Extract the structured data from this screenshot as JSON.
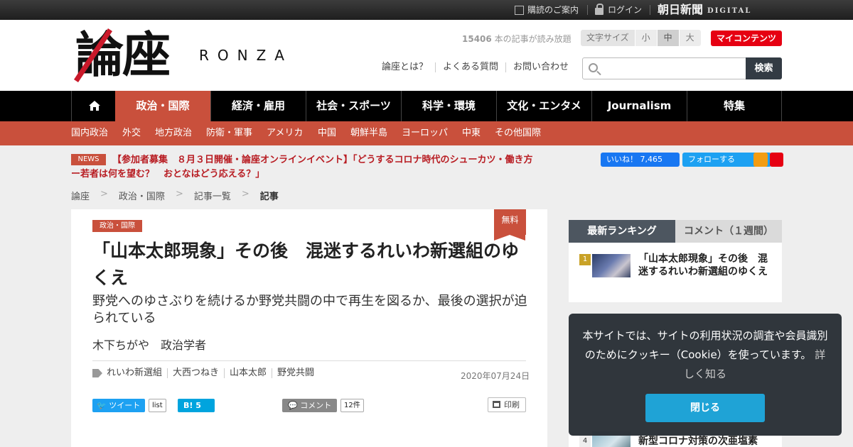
{
  "topbar": {
    "subscribe": "購読のご案内",
    "login": "ログイン",
    "asahi_logo": "朝日新聞",
    "digital": "DIGITAL"
  },
  "header": {
    "logo_kanji": "論座",
    "logo_roman": "RONZA",
    "read_count": "15406",
    "read_count_suffix": "本の記事が読み放題",
    "font_size_label": "文字サイズ",
    "font_sizes": [
      "小",
      "中",
      "大"
    ],
    "font_size_selected": "中",
    "my_content": "マイコンテンツ",
    "links": [
      "論座とは？",
      "よくある質問",
      "お問い合わせ"
    ],
    "search_placeholder": "",
    "search_button": "検索"
  },
  "nav": {
    "tabs": [
      "政治・国際",
      "経済・雇用",
      "社会・スポーツ",
      "科学・環境",
      "文化・エンタメ",
      "Journalism",
      "特集"
    ],
    "active": "政治・国際",
    "subnav": [
      "国内政治",
      "外交",
      "地方政治",
      "防衛・軍事",
      "アメリカ",
      "中国",
      "朝鮮半島",
      "ヨーロッパ",
      "中東",
      "その他国際"
    ]
  },
  "news": {
    "badge": "NEWS",
    "text": "【参加者募集　８月３日開催・論座オンラインイベント】「どうするコロナ時代のシューカツ・働き方ー若者は何を望む？　おとなはどう応える？」"
  },
  "social": {
    "fb_like": "いいね！",
    "fb_count": "7,465",
    "tw_follow": "フォローする"
  },
  "breadcrumb": [
    "論座",
    "政治・国際",
    "記事一覧",
    "記事"
  ],
  "article": {
    "category": "政治・国際",
    "free_badge": "無料",
    "title": "「山本太郎現象」その後　混迷するれいわ新選組のゆくえ",
    "subtitle": "野党へのゆさぶりを続けるか野党共闘の中で再生を図るか、最後の選択が迫られている",
    "author": "木下ちがや　政治学者",
    "tags": [
      "れいわ新選組",
      "大西つねき",
      "山本太郎",
      "野党共闘"
    ],
    "date": "2020年07月24日",
    "tweet": "ツイート",
    "tweet_list": "list",
    "hatena": "B!",
    "hatena_count": "5",
    "comment": "コメント",
    "comment_count": "12件",
    "print": "印刷"
  },
  "sidebar": {
    "tab_ranking": "最新ランキング",
    "tab_comment": "コメント（１週間）",
    "items": [
      {
        "rank": "1",
        "title": "「山本太郎現象」その後　混迷するれいわ新選組のゆくえ"
      },
      {
        "rank": "4",
        "title": "新型コロナ対策の次亜塩素"
      }
    ]
  },
  "cookie": {
    "text": "本サイトでは、サイトの利用状況の調査や会員識別のためにクッキー（Cookie）を使っています。",
    "more": "詳しく知る",
    "close": "閉じる"
  }
}
